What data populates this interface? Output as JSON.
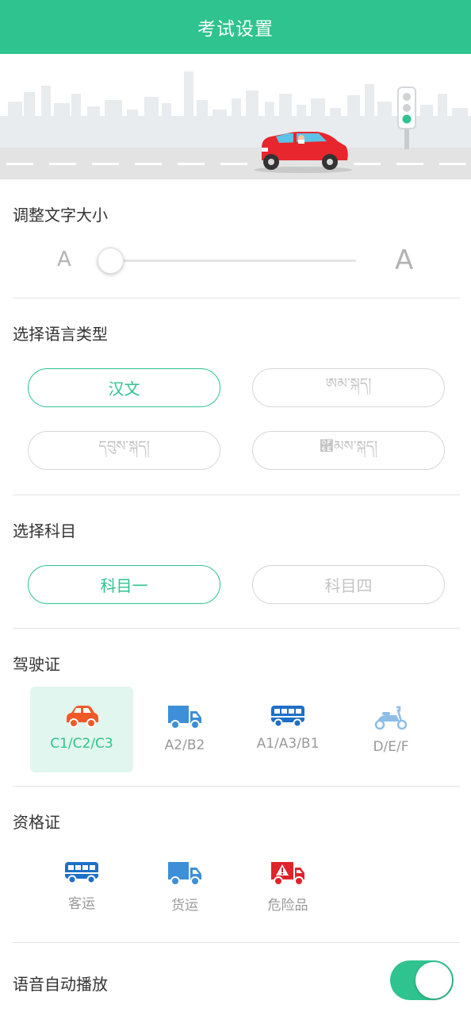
{
  "header": {
    "title": "考试设置"
  },
  "font_size": {
    "title": "调整文字大小",
    "small_label": "A",
    "large_label": "A",
    "level": 0
  },
  "language": {
    "title": "选择语言类型",
    "options": [
      {
        "label": "汉文",
        "selected": true
      },
      {
        "label": "ཨམ་སྐད།",
        "selected": false
      },
      {
        "label": "དབུས་སྐད།",
        "selected": false
      },
      {
        "label": "཮མས་སྐད།",
        "selected": false
      }
    ]
  },
  "subject": {
    "title": "选择科目",
    "options": [
      {
        "label": "科目一",
        "selected": true
      },
      {
        "label": "科目四",
        "selected": false
      }
    ]
  },
  "license": {
    "title": "驾驶证",
    "options": [
      {
        "label": "C1/C2/C3",
        "icon": "car-icon",
        "color": "#f05a28",
        "selected": true
      },
      {
        "label": "A2/B2",
        "icon": "truck-icon",
        "color": "#3d8fd8",
        "selected": false
      },
      {
        "label": "A1/A3/B1",
        "icon": "bus-icon",
        "color": "#1f6fc7",
        "selected": false
      },
      {
        "label": "D/E/F",
        "icon": "scooter-icon",
        "color": "#8ebee8",
        "selected": false
      }
    ]
  },
  "qualification": {
    "title": "资格证",
    "options": [
      {
        "label": "客运",
        "icon": "bus-icon",
        "color": "#1f6fc7"
      },
      {
        "label": "货运",
        "icon": "truck-icon",
        "color": "#3d8fd8"
      },
      {
        "label": "危险品",
        "icon": "hazard-truck-icon",
        "color": "#e0242b"
      }
    ]
  },
  "voice": {
    "title": "语音自动播放",
    "enabled": true
  },
  "colors": {
    "accent": "#2ec38f",
    "muted": "#c4c4c4"
  }
}
